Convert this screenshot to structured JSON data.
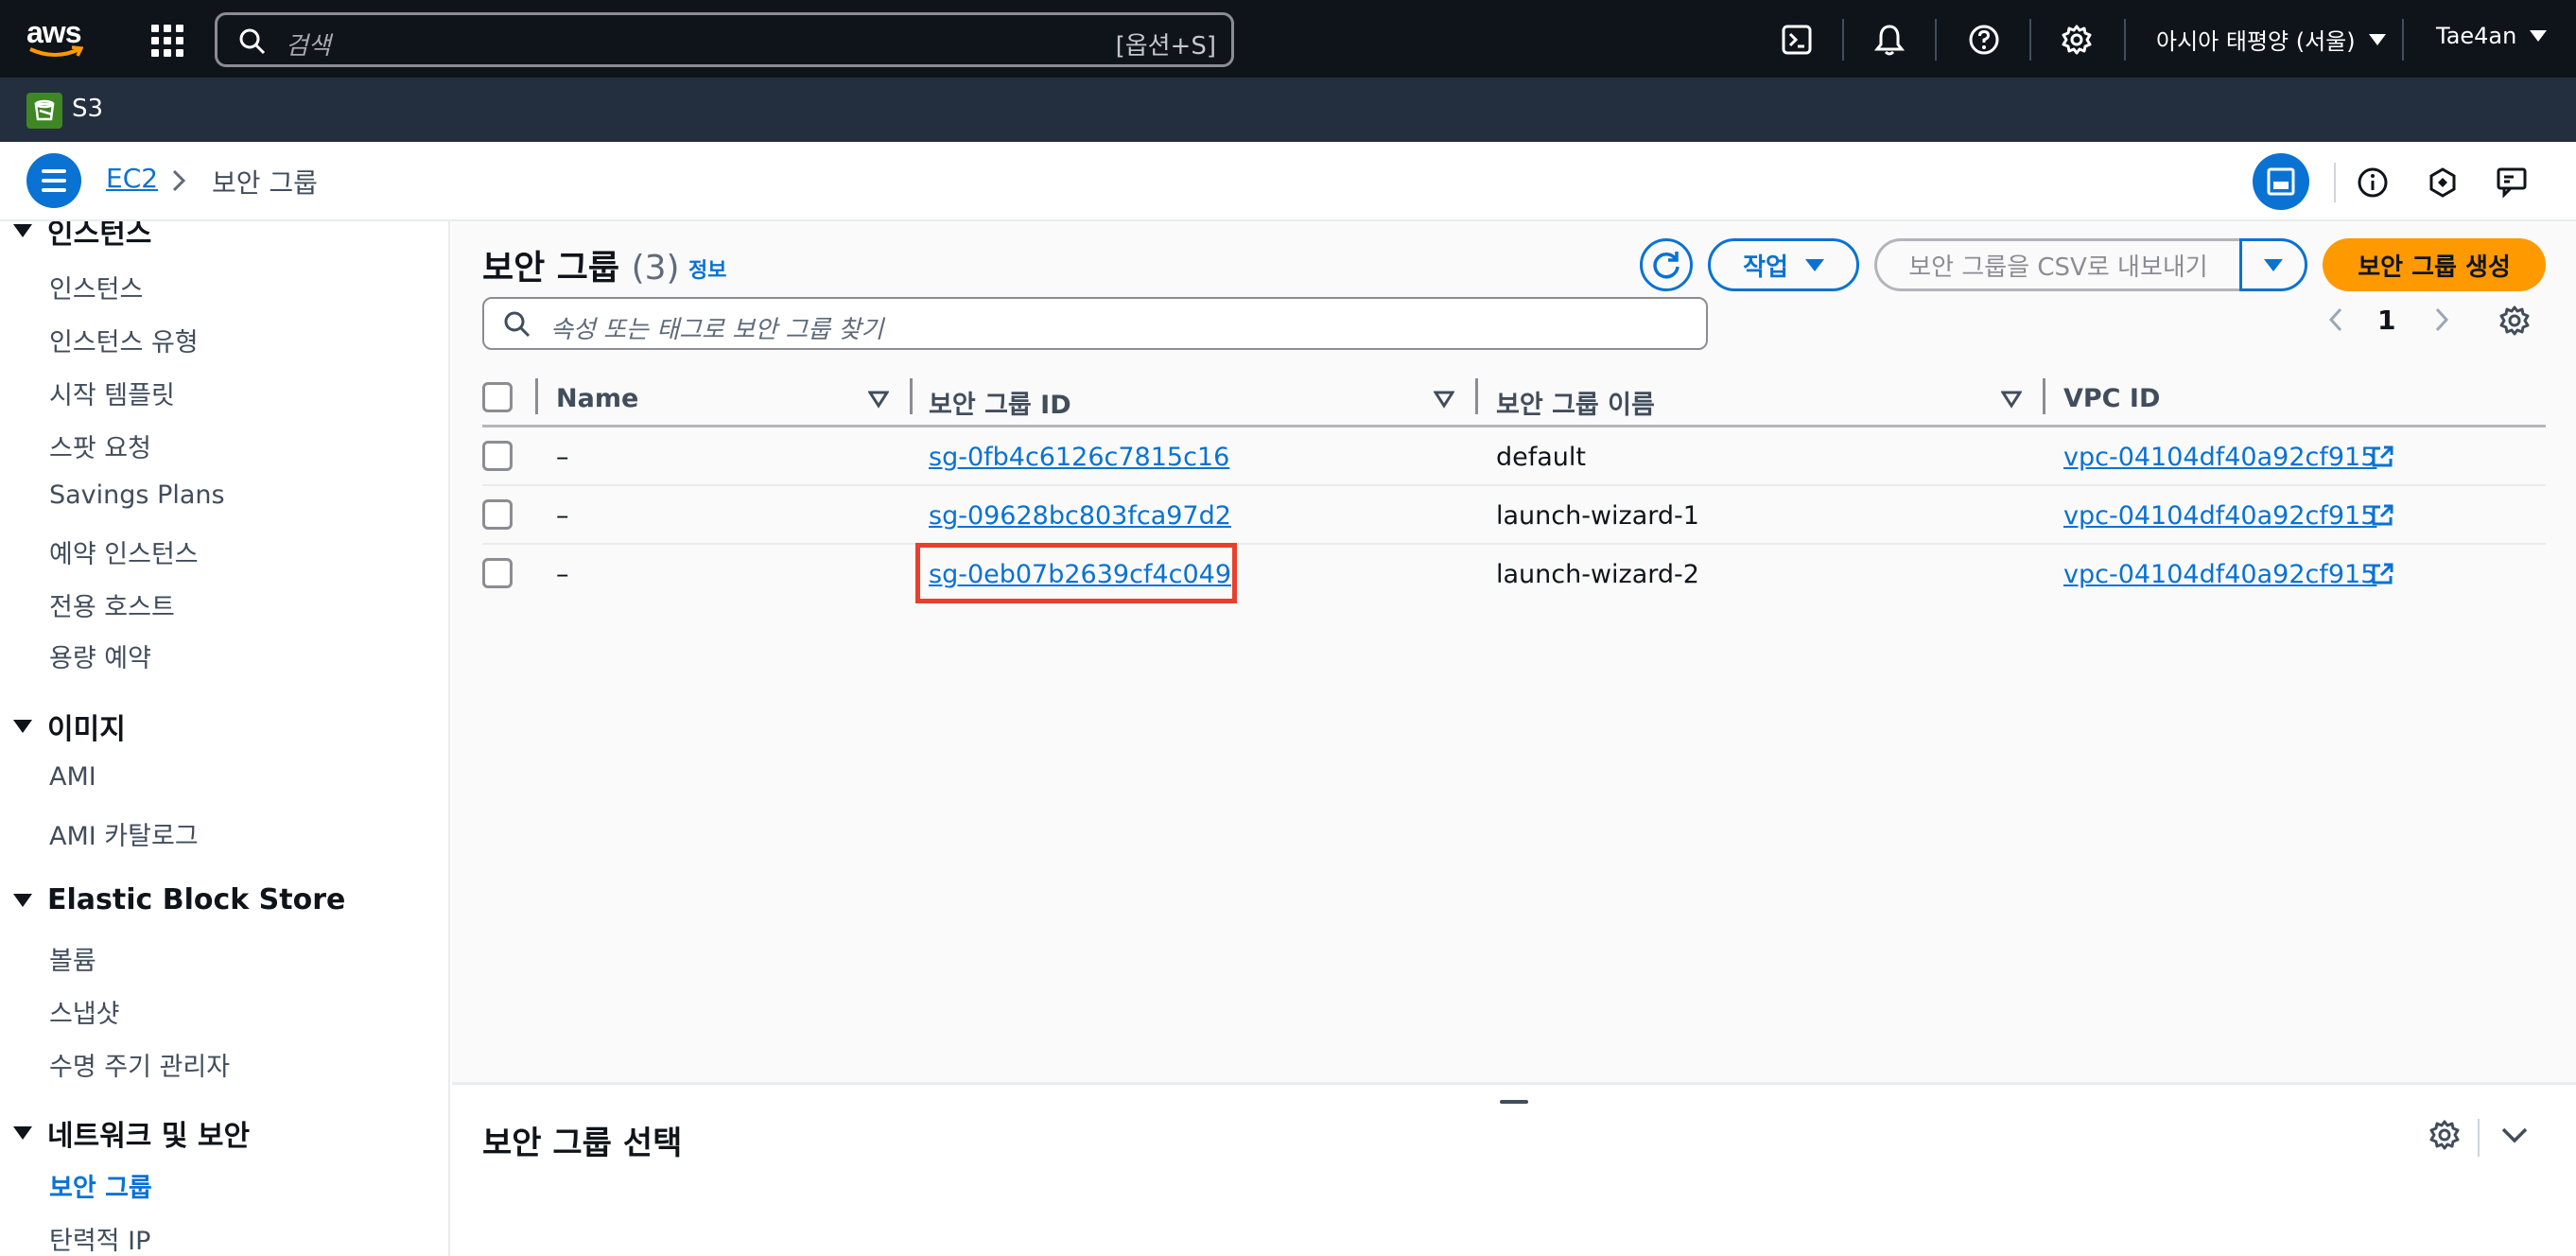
{
  "topnav": {
    "logo_text": "aws",
    "search_placeholder": "검색",
    "search_shortcut": "[옵션+S]",
    "region": "아시아 태평양 (서울)",
    "user": "Tae4an"
  },
  "service_bar": {
    "label": "S3"
  },
  "breadcrumb": {
    "parent": "EC2",
    "current": "보안 그룹"
  },
  "sidebar": {
    "sections": [
      {
        "title": "인스턴스",
        "items": [
          "인스턴스",
          "인스턴스 유형",
          "시작 템플릿",
          "스팟 요청",
          "Savings Plans",
          "예약 인스턴스",
          "전용 호스트",
          "용량 예약"
        ]
      },
      {
        "title": "이미지",
        "items": [
          "AMI",
          "AMI 카탈로그"
        ]
      },
      {
        "title": "Elastic Block Store",
        "items": [
          "볼륨",
          "스냅샷",
          "수명 주기 관리자"
        ]
      },
      {
        "title": "네트워크 및 보안",
        "items": [
          "보안 그룹",
          "탄력적 IP"
        ]
      }
    ],
    "active_item": "보안 그룹"
  },
  "main": {
    "title": "보안 그룹",
    "count": "(3)",
    "info": "정보",
    "actions_label": "작업",
    "export_label": "보안 그룹을 CSV로 내보내기",
    "create_label": "보안 그룹 생성",
    "filter_placeholder": "속성 또는 태그로 보안 그룹 찾기",
    "page": "1"
  },
  "table": {
    "columns": [
      "Name",
      "보안 그룹 ID",
      "보안 그룹 이름",
      "VPC ID"
    ],
    "rows": [
      {
        "name": "–",
        "id": "sg-0fb4c6126c7815c16",
        "group_name": "default",
        "vpc": "vpc-04104df40a92cf915"
      },
      {
        "name": "–",
        "id": "sg-09628bc803fca97d2",
        "group_name": "launch-wizard-1",
        "vpc": "vpc-04104df40a92cf915"
      },
      {
        "name": "–",
        "id": "sg-0eb07b2639cf4c049",
        "group_name": "launch-wizard-2",
        "vpc": "vpc-04104df40a92cf915"
      }
    ]
  },
  "split_panel": {
    "title": "보안 그룹 선택"
  },
  "colors": {
    "accent": "#0972d3",
    "primary_button": "#ff9900",
    "highlight": "#e8402c",
    "nav_bg": "#0f141a"
  }
}
